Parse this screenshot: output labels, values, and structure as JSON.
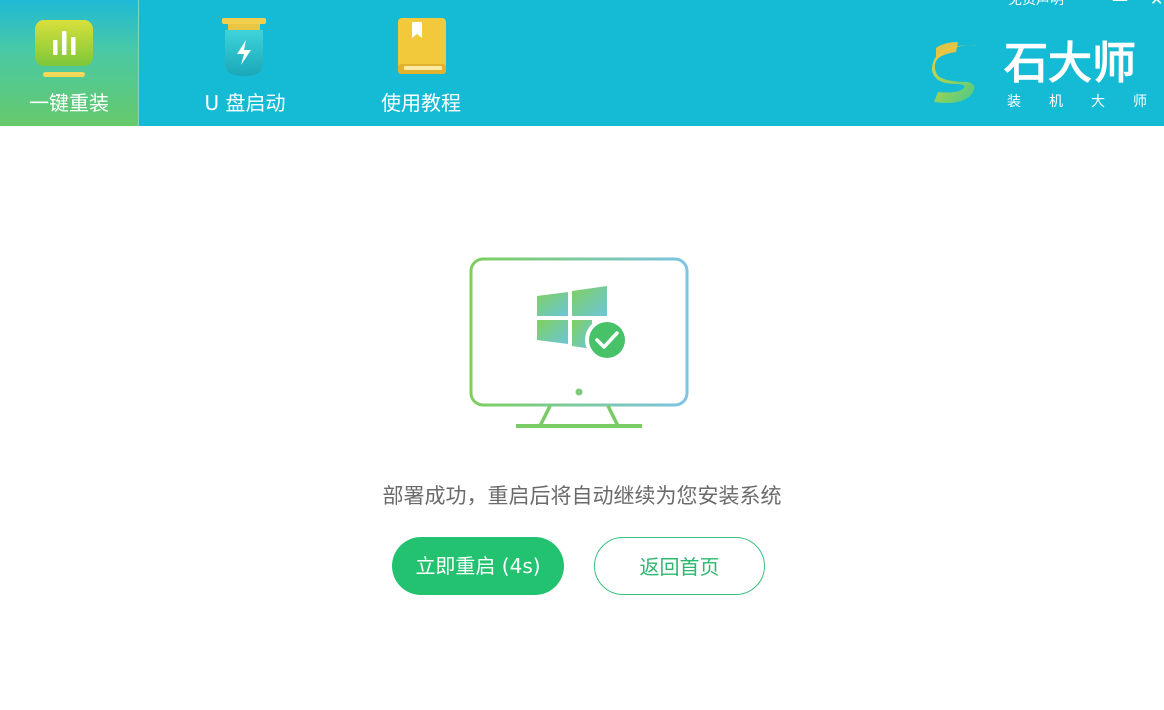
{
  "header": {
    "tabs": [
      {
        "label": "一键重装",
        "icon": "bar-chart-icon",
        "active": true
      },
      {
        "label": "U 盘启动",
        "icon": "usb-drive-icon",
        "active": false
      },
      {
        "label": "使用教程",
        "icon": "book-icon",
        "active": false
      }
    ],
    "disclaimer": "免责声明",
    "brand": {
      "name": "石大师",
      "sub_chars": [
        "装",
        "机",
        "大",
        "师"
      ]
    }
  },
  "main": {
    "illustration": "monitor-windows-check-icon",
    "message": "部署成功，重启后将自动继续为您安装系统",
    "restart_button": "立即重启 (4s)",
    "home_button": "返回首页"
  },
  "colors": {
    "header_bg": "#15bbd5",
    "primary_green": "#23c271",
    "text_gray": "#6b6b6b"
  }
}
